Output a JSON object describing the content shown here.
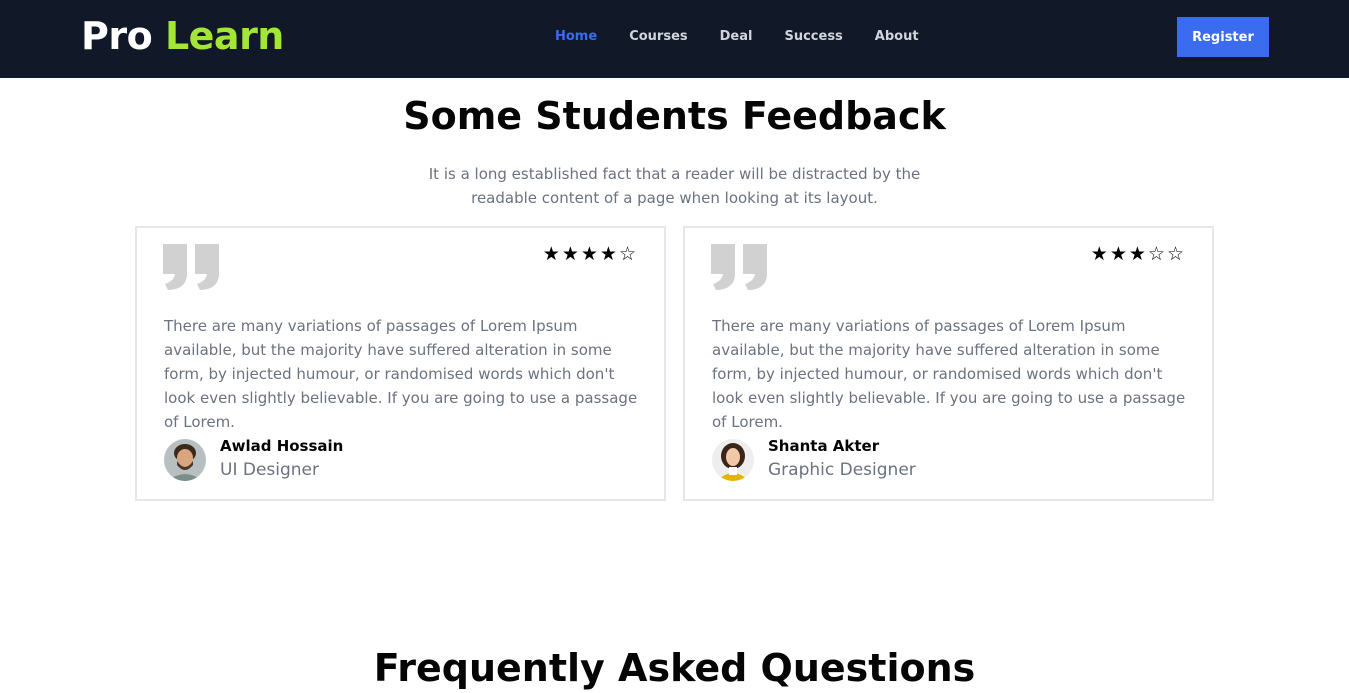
{
  "brand": {
    "part1": "Pro",
    "part2": "Learn",
    "color_part2": "#a3e635"
  },
  "nav": {
    "items": [
      {
        "label": "Home",
        "active": true
      },
      {
        "label": "Courses",
        "active": false
      },
      {
        "label": "Deal",
        "active": false
      },
      {
        "label": "Success",
        "active": false
      },
      {
        "label": "About",
        "active": false
      }
    ],
    "register_label": "Register"
  },
  "feedback": {
    "title": "Some Students Feedback",
    "subtitle": "It is a long established fact that a reader will be distracted by the readable content of a page when looking at its layout.",
    "cards": [
      {
        "rating": 4,
        "max_rating": 5,
        "text": "There are many variations of passages of Lorem Ipsum available, but the majority have suffered alteration in some form, by injected humour, or randomised words which don't look even slightly believable. If you are going to use a passage of Lorem.",
        "name": "Awlad Hossain",
        "role": "UI Designer"
      },
      {
        "rating": 3,
        "max_rating": 5,
        "text": "There are many variations of passages of Lorem Ipsum available, but the majority have suffered alteration in some form, by injected humour, or randomised words which don't look even slightly believable. If you are going to use a passage of Lorem.",
        "name": "Shanta Akter",
        "role": "Graphic Designer"
      }
    ]
  },
  "faq": {
    "title": "Frequently Asked Questions"
  },
  "colors": {
    "navbar_bg": "#111827",
    "accent": "#3b6cf0",
    "muted_text": "#6b7280",
    "card_border": "#e5e7eb",
    "quote_icon": "#d1d1d1"
  }
}
